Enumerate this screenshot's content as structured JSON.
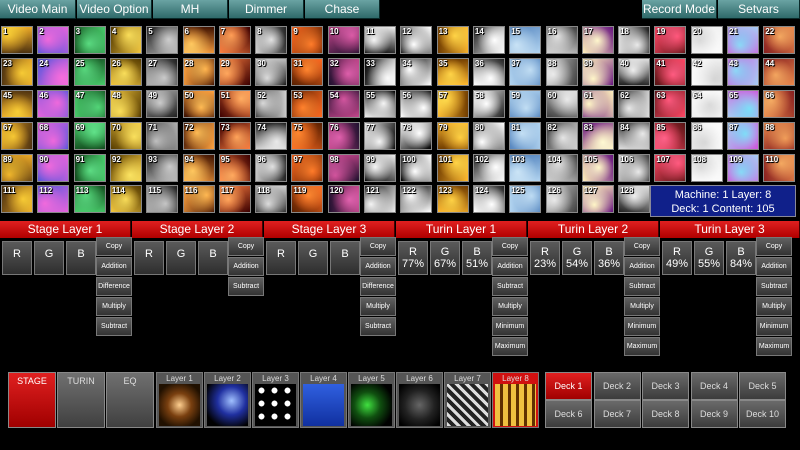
{
  "top_tabs": [
    "Video Main",
    "Video Option",
    "MH",
    "Dimmer",
    "Chase"
  ],
  "top_right_tabs": [
    "Record Mode",
    "Setvars"
  ],
  "clip_numbers": [
    "1",
    "2",
    "3",
    "4",
    "5",
    "6",
    "7",
    "8",
    "9",
    "10",
    "11",
    "12",
    "13",
    "14",
    "15",
    "16",
    "17",
    "18",
    "19",
    "20",
    "21",
    "22",
    "23",
    "24",
    "25",
    "26",
    "27",
    "28",
    "29",
    "30",
    "31",
    "32",
    "33",
    "34",
    "35",
    "36",
    "37",
    "38",
    "39",
    "40",
    "41",
    "42",
    "43",
    "44",
    "45",
    "46",
    "47",
    "48",
    "49",
    "50",
    "51",
    "52",
    "53",
    "54",
    "55",
    "56",
    "57",
    "58",
    "59",
    "60",
    "61",
    "62",
    "63",
    "64",
    "65",
    "66",
    "67",
    "68",
    "69",
    "70",
    "71",
    "72",
    "73",
    "74",
    "75",
    "76",
    "77",
    "78",
    "79",
    "80",
    "81",
    "82",
    "83",
    "84",
    "85",
    "86",
    "87",
    "88",
    "89",
    "90",
    "91",
    "92",
    "93",
    "94",
    "95",
    "96",
    "97",
    "98",
    "99",
    "100",
    "101",
    "102",
    "103",
    "104",
    "105",
    "106",
    "107",
    "108",
    "109",
    "110",
    "111",
    "112",
    "113",
    "114",
    "115",
    "116",
    "117",
    "118",
    "119",
    "120",
    "121",
    "122",
    "123",
    "124",
    "125",
    "126",
    "127",
    "128"
  ],
  "info": {
    "line1": "Machine: 1 Layer: 8",
    "line2": "Deck: 1 Content: 105"
  },
  "layers": [
    {
      "title": "Stage Layer 1",
      "r": "R",
      "g": "G",
      "b": "B",
      "modes": [
        "Copy",
        "Addition",
        "Difference",
        "Multiply",
        "Subtract"
      ]
    },
    {
      "title": "Stage Layer 2",
      "r": "R",
      "g": "G",
      "b": "B",
      "modes": [
        "Copy",
        "Addition",
        "Subtract"
      ]
    },
    {
      "title": "Stage Layer 3",
      "r": "R",
      "g": "G",
      "b": "B",
      "modes": [
        "Copy",
        "Addition",
        "Difference",
        "Multiply",
        "Subtract"
      ]
    },
    {
      "title": "Turin Layer 1",
      "r": "R",
      "g": "G",
      "b": "B",
      "rv": "77%",
      "gv": "67%",
      "bv": "51%",
      "modes": [
        "Copy",
        "Addition",
        "Subtract",
        "Multiply",
        "Minimum",
        "Maximum"
      ]
    },
    {
      "title": "Turin Layer 2",
      "r": "R",
      "g": "G",
      "b": "B",
      "rv": "23%",
      "gv": "54%",
      "bv": "36%",
      "modes": [
        "Copy",
        "Addition",
        "Subtract",
        "Multiply",
        "Minimum",
        "Maximum"
      ]
    },
    {
      "title": "Turin Layer 3",
      "r": "R",
      "g": "G",
      "b": "B",
      "rv": "49%",
      "gv": "55%",
      "bv": "84%",
      "modes": [
        "Copy",
        "Addition",
        "Subtract",
        "Multiply",
        "Minimum",
        "Maximum"
      ]
    }
  ],
  "modes": [
    "STAGE",
    "TURIN",
    "EQ"
  ],
  "layer_thumbs": [
    "Layer 1",
    "Layer 2",
    "Layer 3",
    "Layer 4",
    "Layer 5",
    "Layer 6",
    "Layer 7",
    "Layer 8"
  ],
  "decks": [
    "Deck 1",
    "Deck 2",
    "Deck 3",
    "Deck 4",
    "Deck 5",
    "Deck 6",
    "Deck 7",
    "Deck 8",
    "Deck 9",
    "Deck 10"
  ],
  "colors": {
    "accent_red": "#d01010",
    "tab_teal": "#4a8888",
    "info_blue": "#10208a"
  }
}
